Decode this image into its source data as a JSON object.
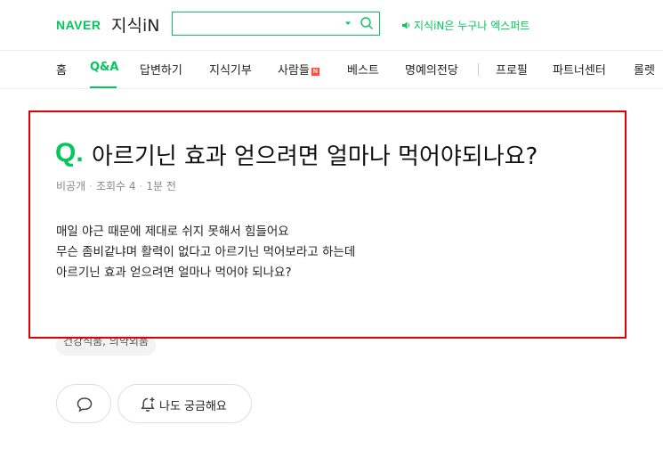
{
  "header": {
    "logo_naver": "NAVER",
    "logo_kin": "지식iN",
    "search_placeholder": "",
    "promo_text": "지식iN은 누구나 엑스퍼트"
  },
  "colors": {
    "brand_green": "#03c75a",
    "highlight_red": "#e00000",
    "badge_red": "#ff4e3b"
  },
  "nav": {
    "tabs": [
      {
        "label": "홈"
      },
      {
        "label": "Q&A",
        "active": true
      },
      {
        "label": "답변하기"
      },
      {
        "label": "지식기부"
      },
      {
        "label": "사람들",
        "badge": "N"
      },
      {
        "label": "베스트"
      },
      {
        "label": "명예의전당"
      },
      {
        "label": "프로필"
      },
      {
        "label": "파트너센터"
      },
      {
        "label": "롤렛"
      }
    ]
  },
  "question": {
    "q_mark": "Q.",
    "title": "아르기닌 효과 얻으려면 얼마나 먹어야되나요?",
    "author": "비공개",
    "views_label": "조회수 4",
    "time": "1분 전",
    "body_lines": [
      "매일 야근 때문에 제대로 쉬지 못해서 힘들어요",
      "무슨 좀비같냐며 활력이 없다고 아르기닌 먹어보라고 하는데",
      "아르기닌 효과 얻으려면 얼마나 먹어야 되나요?"
    ],
    "tag": "건강식품, 의약외품"
  },
  "actions": {
    "comment_icon": "speech-bubble-icon",
    "curious_icon": "bell-plus-icon",
    "curious_label": "나도 궁금해요"
  }
}
